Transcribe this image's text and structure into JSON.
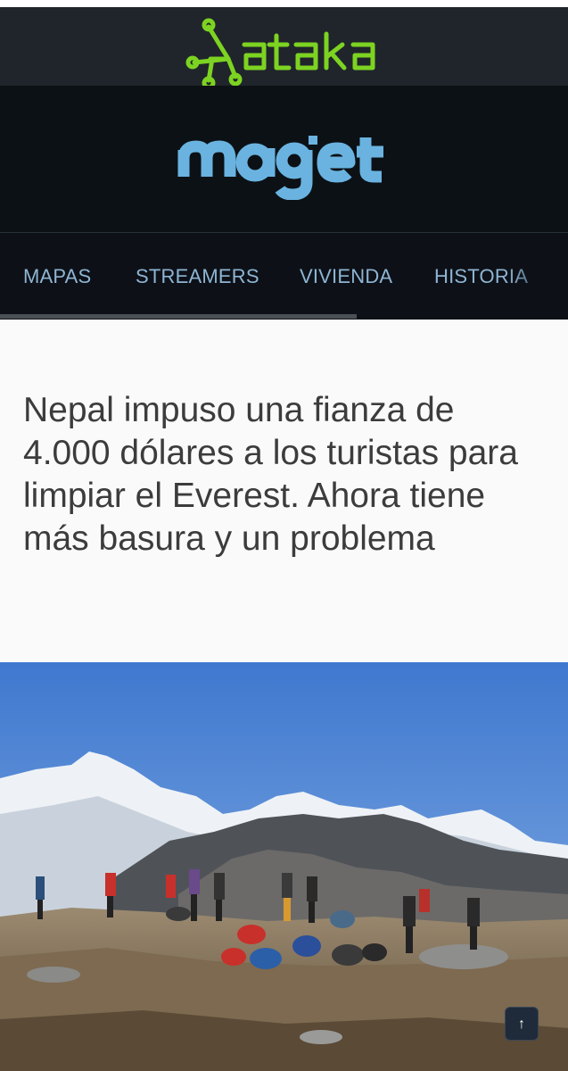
{
  "brand": {
    "network_logo": "xataka",
    "site_logo": "magnet",
    "network_color": "#7dd321",
    "site_color": "#6ab3e0"
  },
  "nav": {
    "items": [
      {
        "label": "MAPAS"
      },
      {
        "label": "STREAMERS"
      },
      {
        "label": "VIVIENDA"
      },
      {
        "label": "HISTORIA"
      }
    ]
  },
  "article": {
    "headline": "Nepal impuso una fianza de 4.000 dólares a los turistas para limpiar el Everest. Ahora tiene más basura y un problema",
    "hero_image": "trekkers-on-himalaya-ridge"
  },
  "controls": {
    "back_to_top_icon": "arrow-up-icon",
    "back_to_top_label": "↑"
  }
}
